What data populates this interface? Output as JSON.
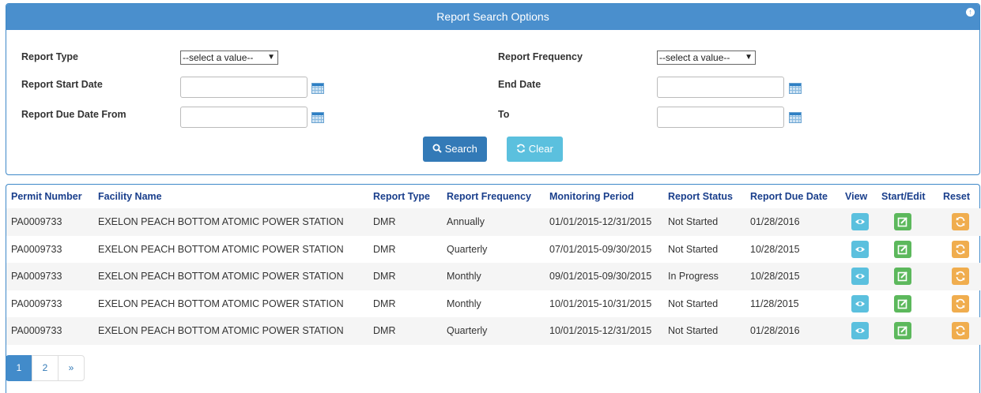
{
  "search_panel": {
    "title": "Report Search Options",
    "report_type": {
      "label": "Report Type",
      "value": "--select a value--"
    },
    "report_frequency": {
      "label": "Report Frequency",
      "value": "--select a value--"
    },
    "report_start_date": {
      "label": "Report Start Date",
      "value": ""
    },
    "end_date": {
      "label": "End Date",
      "value": ""
    },
    "report_due_date_from": {
      "label": "Report Due Date From",
      "value": ""
    },
    "to": {
      "label": "To",
      "value": ""
    },
    "search_label": "Search",
    "clear_label": "Clear"
  },
  "table": {
    "columns": [
      "Permit Number",
      "Facility Name",
      "Report Type",
      "Report Frequency",
      "Monitoring Period",
      "Report Status",
      "Report Due Date",
      "View",
      "Start/Edit",
      "Reset"
    ],
    "rows": [
      [
        "PA0009733",
        "EXELON PEACH BOTTOM ATOMIC POWER STATION",
        "DMR",
        "Annually",
        "01/01/2015-12/31/2015",
        "Not Started",
        "01/28/2016"
      ],
      [
        "PA0009733",
        "EXELON PEACH BOTTOM ATOMIC POWER STATION",
        "DMR",
        "Quarterly",
        "07/01/2015-09/30/2015",
        "Not Started",
        "10/28/2015"
      ],
      [
        "PA0009733",
        "EXELON PEACH BOTTOM ATOMIC POWER STATION",
        "DMR",
        "Monthly",
        "09/01/2015-09/30/2015",
        "In Progress",
        "10/28/2015"
      ],
      [
        "PA0009733",
        "EXELON PEACH BOTTOM ATOMIC POWER STATION",
        "DMR",
        "Monthly",
        "10/01/2015-10/31/2015",
        "Not Started",
        "11/28/2015"
      ],
      [
        "PA0009733",
        "EXELON PEACH BOTTOM ATOMIC POWER STATION",
        "DMR",
        "Quarterly",
        "10/01/2015-12/31/2015",
        "Not Started",
        "01/28/2016"
      ]
    ]
  },
  "pagination": {
    "pages": [
      "1",
      "2"
    ],
    "next": "»",
    "current": "1"
  },
  "colors": {
    "primary": "#4a8fcd",
    "view": "#5bc0de",
    "edit": "#5cb85c",
    "reset": "#f0ad4e",
    "header_text": "#1a3f8c"
  }
}
